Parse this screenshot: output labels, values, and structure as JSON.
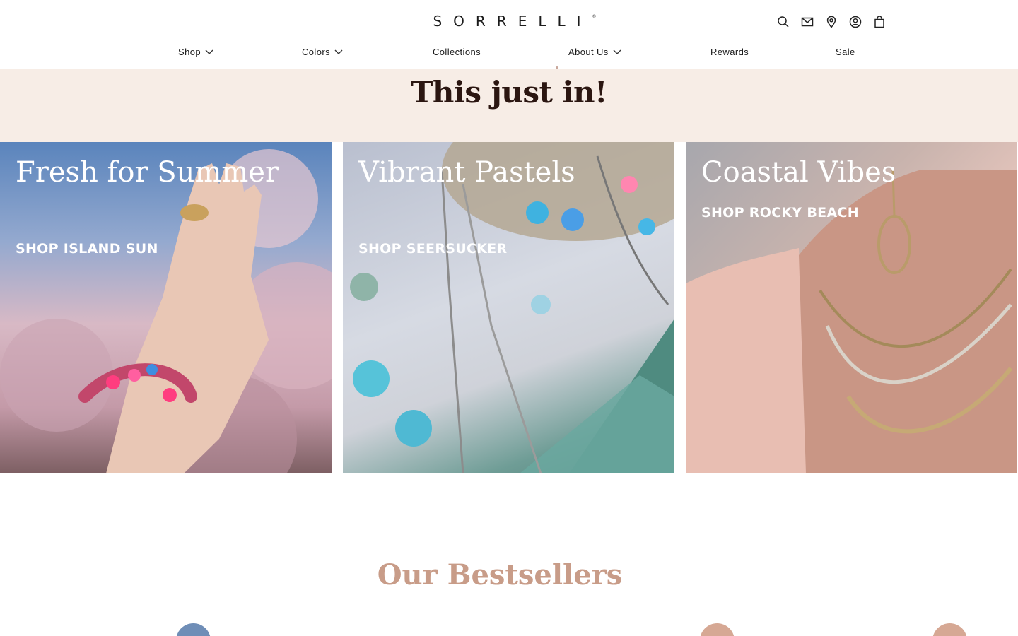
{
  "brand": {
    "name": "SORRELLI",
    "mark": "®"
  },
  "header_icons": [
    "search-icon",
    "mail-icon",
    "location-pin-icon",
    "account-icon",
    "shopping-bag-icon"
  ],
  "nav": {
    "items": [
      {
        "label": "Shop",
        "has_dropdown": true
      },
      {
        "label": "Colors",
        "has_dropdown": true
      },
      {
        "label": "Collections",
        "has_dropdown": false
      },
      {
        "label": "About Us",
        "has_dropdown": true
      },
      {
        "label": "Rewards",
        "has_dropdown": false
      },
      {
        "label": "Sale",
        "has_dropdown": false
      }
    ]
  },
  "banner": {
    "title": "This just in!"
  },
  "cards": [
    {
      "title": "Fresh for Summer",
      "link": "SHOP ISLAND SUN"
    },
    {
      "title": "Vibrant Pastels",
      "link": "SHOP SEERSUCKER"
    },
    {
      "title": "Coastal Vibes",
      "link": "SHOP ROCKY BEACH"
    }
  ],
  "bestsellers": {
    "title": "Our Bestsellers"
  },
  "colors": {
    "banner_bg": "#f7ede6",
    "banner_title": "#2b1611",
    "bestsellers_title": "#c89c88",
    "dot_blue": "#6f8eb7",
    "dot_rose": "#d6a894"
  }
}
